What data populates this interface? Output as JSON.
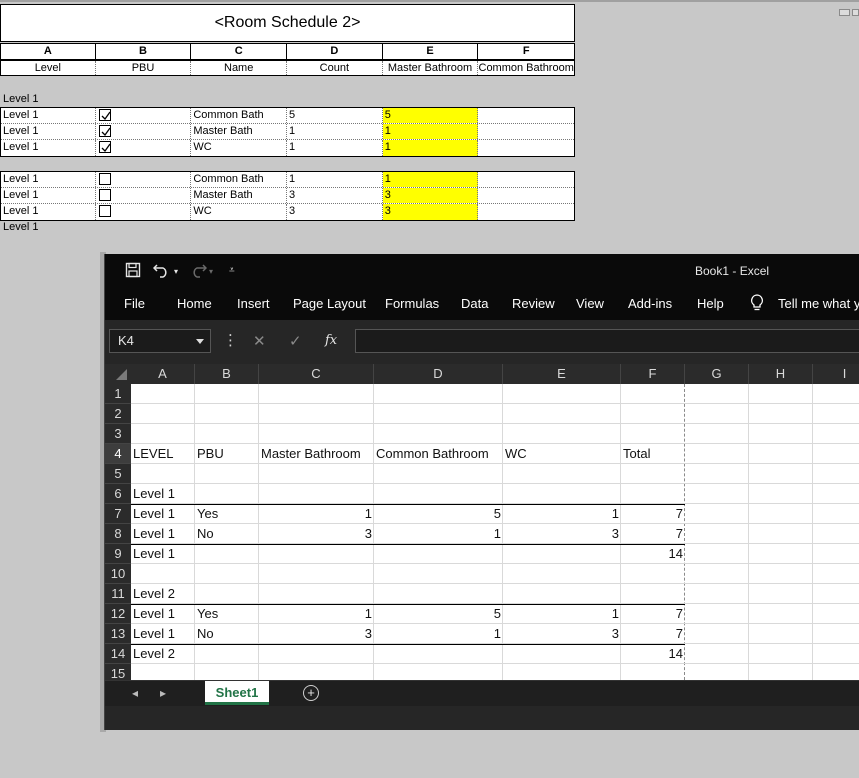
{
  "revit": {
    "title": "<Room Schedule 2>",
    "col_letters": [
      "A",
      "B",
      "C",
      "D",
      "E",
      "F"
    ],
    "col_headers": [
      "Level",
      "PBU",
      "Name",
      "Count",
      "Master Bathroom",
      "Common Bathroom"
    ],
    "group_header": "Level 1",
    "group_footer": "Level 1",
    "block1": [
      {
        "level": "Level 1",
        "pbu": true,
        "name": "Common Bath",
        "count": "5",
        "master": "5"
      },
      {
        "level": "Level 1",
        "pbu": true,
        "name": "Master Bath",
        "count": "1",
        "master": "1"
      },
      {
        "level": "Level 1",
        "pbu": true,
        "name": "WC",
        "count": "1",
        "master": "1"
      }
    ],
    "block2": [
      {
        "level": "Level 1",
        "pbu": false,
        "name": "Common Bath",
        "count": "1",
        "master": "1"
      },
      {
        "level": "Level 1",
        "pbu": false,
        "name": "Master Bath",
        "count": "3",
        "master": "3"
      },
      {
        "level": "Level 1",
        "pbu": false,
        "name": "WC",
        "count": "3",
        "master": "3"
      }
    ],
    "highlight_color": "#ffff00"
  },
  "excel": {
    "title": "Book1  -  Excel",
    "ribbon_tabs": [
      "File",
      "Home",
      "Insert",
      "Page Layout",
      "Formulas",
      "Data",
      "Review",
      "View",
      "Add-ins",
      "Help"
    ],
    "tell_me": "Tell me what yo",
    "name_box": "K4",
    "formula_icons": [
      "cancel-icon",
      "enter-icon",
      "function-icon"
    ],
    "fx_label": "fx",
    "columns": [
      "A",
      "B",
      "C",
      "D",
      "E",
      "F",
      "G",
      "H",
      "I"
    ],
    "row_numbers": [
      "1",
      "2",
      "3",
      "4",
      "5",
      "6",
      "7",
      "8",
      "9",
      "10",
      "11",
      "12",
      "13",
      "14",
      "15"
    ],
    "selected_row": "4",
    "header_row": {
      "a": "LEVEL",
      "b": "PBU",
      "c": "Master Bathroom",
      "d": "Common Bathroom",
      "e": "WC",
      "f": "Total"
    },
    "rows": {
      "r6": {
        "a": "Level 1"
      },
      "r7": {
        "a": "Level 1",
        "b": "Yes",
        "c": "1",
        "d": "5",
        "e": "1",
        "f": "7"
      },
      "r8": {
        "a": "Level 1",
        "b": "No",
        "c": "3",
        "d": "1",
        "e": "3",
        "f": "7"
      },
      "r9": {
        "a": "Level 1",
        "f": "14"
      },
      "r11": {
        "a": "Level 2"
      },
      "r12": {
        "a": "Level 1",
        "b": "Yes",
        "c": "1",
        "d": "5",
        "e": "1",
        "f": "7"
      },
      "r13": {
        "a": "Level 1",
        "b": "No",
        "c": "3",
        "d": "1",
        "e": "3",
        "f": "7"
      },
      "r14": {
        "a": "Level 2",
        "f": "14"
      }
    },
    "sheet_tab": "Sheet1",
    "add_sheet": "+",
    "accent_color": "#217346"
  }
}
